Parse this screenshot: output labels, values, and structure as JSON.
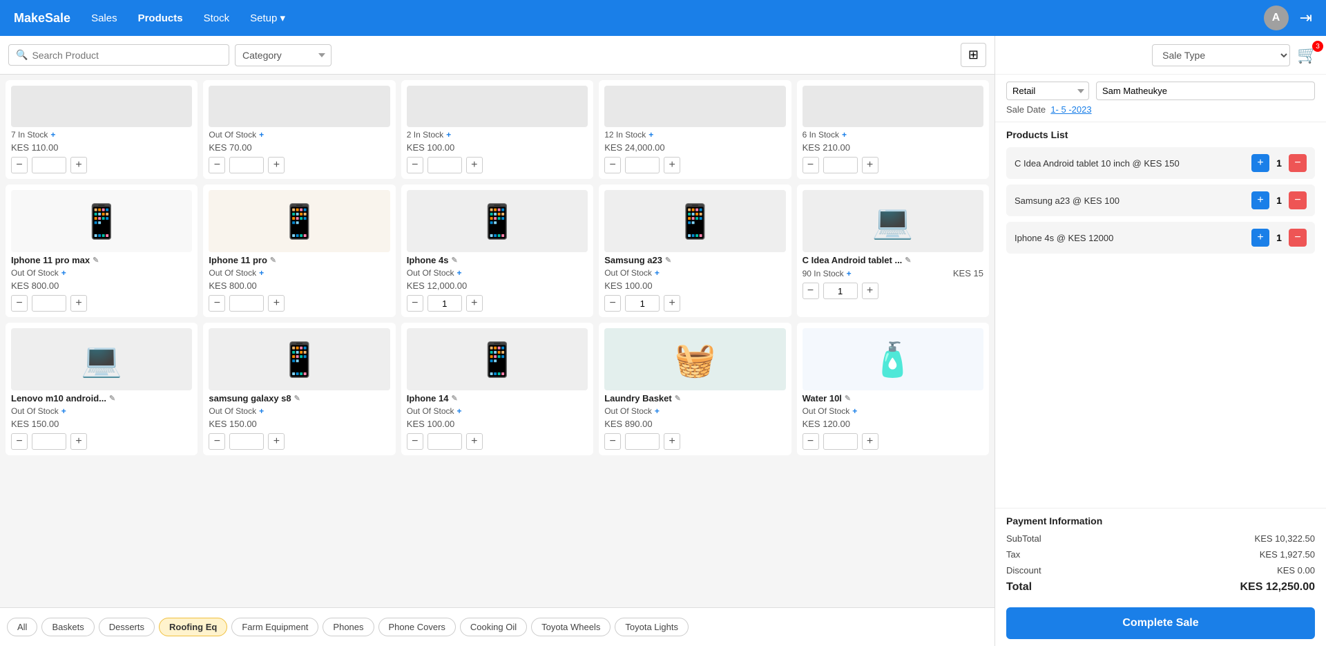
{
  "navbar": {
    "brand": "MakeSale",
    "links": [
      "Sales",
      "Products",
      "Stock",
      "Setup ▾"
    ],
    "active_link": "Products",
    "avatar_letter": "A"
  },
  "search": {
    "placeholder": "Search Product",
    "category_placeholder": "Category"
  },
  "categories": [
    "All",
    "Baskets",
    "Desserts",
    "Roofing Eq",
    "Farm Equipment",
    "Phones",
    "Phone Covers",
    "Cooking Oil",
    "Toyota Wheels",
    "Toyota Lights"
  ],
  "products": [
    {
      "id": 1,
      "name": "",
      "stock": "7 In Stock",
      "price": "KES 110.00",
      "qty": "",
      "has_image": false
    },
    {
      "id": 2,
      "name": "",
      "stock": "Out Of Stock",
      "price": "KES 70.00",
      "qty": "",
      "has_image": false
    },
    {
      "id": 3,
      "name": "",
      "stock": "2 In Stock",
      "price": "KES 100.00",
      "qty": "",
      "has_image": false
    },
    {
      "id": 4,
      "name": "",
      "stock": "12 In Stock",
      "price": "KES 24,000.00",
      "qty": "",
      "has_image": false
    },
    {
      "id": 5,
      "name": "",
      "stock": "6 In Stock",
      "price": "KES 210.00",
      "qty": "",
      "has_image": false
    },
    {
      "id": 6,
      "name": "Iphone 11 pro max",
      "stock": "Out Of Stock",
      "price": "KES 800.00",
      "qty": "",
      "color": "#c8c8c8",
      "emoji": "📱"
    },
    {
      "id": 7,
      "name": "Iphone 11 pro",
      "stock": "Out Of Stock",
      "price": "KES 800.00",
      "qty": "",
      "color": "#d4b07a",
      "emoji": "📱"
    },
    {
      "id": 8,
      "name": "Iphone 4s",
      "stock": "Out Of Stock",
      "price": "KES 12,000.00",
      "qty": "1",
      "color": "#888",
      "emoji": "📱"
    },
    {
      "id": 9,
      "name": "Samsung a23",
      "stock": "Out Of Stock",
      "price": "KES 100.00",
      "qty": "1",
      "color": "#333",
      "emoji": "📱"
    },
    {
      "id": 10,
      "name": "C Idea Android tablet ...",
      "stock": "90 In Stock",
      "price": "KES 15",
      "qty": "1",
      "color": "#5a9",
      "emoji": "💻"
    },
    {
      "id": 11,
      "name": "Lenovo m10 android...",
      "stock": "Out Of Stock",
      "price": "KES 150.00",
      "qty": "",
      "color": "#888",
      "emoji": "💻"
    },
    {
      "id": 12,
      "name": "samsung galaxy s8",
      "stock": "Out Of Stock",
      "price": "KES 150.00",
      "qty": "",
      "color": "#334",
      "emoji": "📱"
    },
    {
      "id": 13,
      "name": "Iphone 14",
      "stock": "Out Of Stock",
      "price": "KES 100.00",
      "qty": "",
      "color": "#6a5",
      "emoji": "📱"
    },
    {
      "id": 14,
      "name": "Laundry Basket",
      "stock": "Out Of Stock",
      "price": "KES 890.00",
      "qty": "",
      "color": "#2a8a7a",
      "emoji": "🧺"
    },
    {
      "id": 15,
      "name": "Water 10l",
      "stock": "Out Of Stock",
      "price": "KES 120.00",
      "qty": "",
      "color": "#aaccee",
      "emoji": "🧴"
    }
  ],
  "right_panel": {
    "sale_type_label": "Sale Type",
    "cart_count": "3",
    "type_options": [
      "Retail"
    ],
    "selected_type": "Retail",
    "sale_person": "Sam Matheukye",
    "sale_date_label": "Sale Date",
    "sale_date_value": "1- 5 -2023",
    "products_list_title": "Products List",
    "cart_items": [
      {
        "desc": "C Idea Android tablet 10 inch @ KES 150",
        "qty": "1"
      },
      {
        "desc": "Samsung a23 @ KES 100",
        "qty": "1"
      },
      {
        "desc": "Iphone 4s @ KES 12000",
        "qty": "1"
      }
    ],
    "payment": {
      "title": "Payment Information",
      "subtotal_label": "SubTotal",
      "subtotal_value": "KES 10,322.50",
      "tax_label": "Tax",
      "tax_value": "KES 1,927.50",
      "discount_label": "Discount",
      "discount_value": "KES 0.00",
      "total_label": "Total",
      "total_value": "KES 12,250.00"
    },
    "complete_btn": "Complete Sale"
  }
}
